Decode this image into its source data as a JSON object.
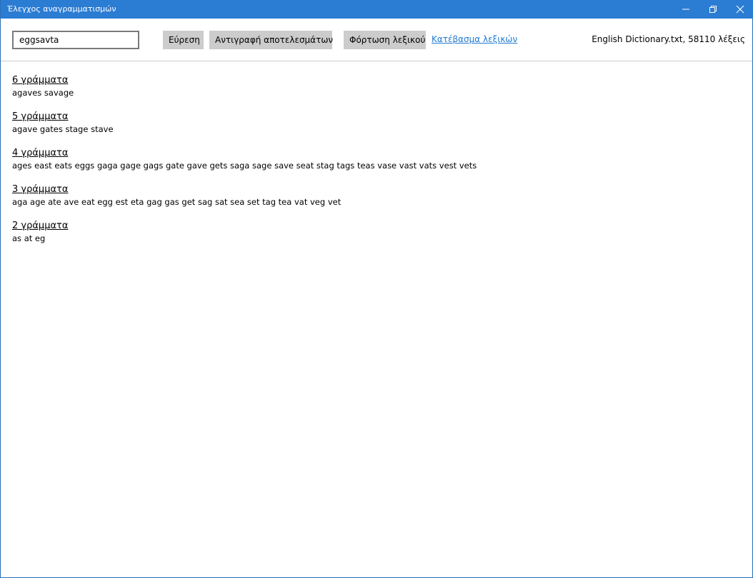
{
  "window": {
    "title": "Έλεγχος αναγραμματισμών",
    "minimize_icon": "minimize-icon",
    "maximize_icon": "restore-icon",
    "close_icon": "close-icon",
    "titlebar_color": "#2b7cd3"
  },
  "toolbar": {
    "search_value": "eggsavta",
    "find_label": "Εύρεση",
    "copy_label": "Αντιγραφή αποτελεσμάτων",
    "load_label": "Φόρτωση λεξικού",
    "download_link": "Κατέβασμα λεξικών",
    "dictionary_status": "English Dictionary.txt, 58110 λέξεις",
    "link_color": "#1f7ad1",
    "button_color": "#cccccc"
  },
  "results": [
    {
      "heading": "6 γράμματα",
      "words": "agaves savage"
    },
    {
      "heading": "5 γράμματα",
      "words": "agave gates stage stave"
    },
    {
      "heading": "4 γράμματα",
      "words": "ages east eats eggs gaga gage gags gate gave gets saga sage save seat stag tags teas vase vast vats vest vets"
    },
    {
      "heading": "3 γράμματα",
      "words": "aga age ate ave eat egg est eta gag gas get sag sat sea set tag tea vat veg vet"
    },
    {
      "heading": "2 γράμματα",
      "words": "as at eg"
    }
  ]
}
